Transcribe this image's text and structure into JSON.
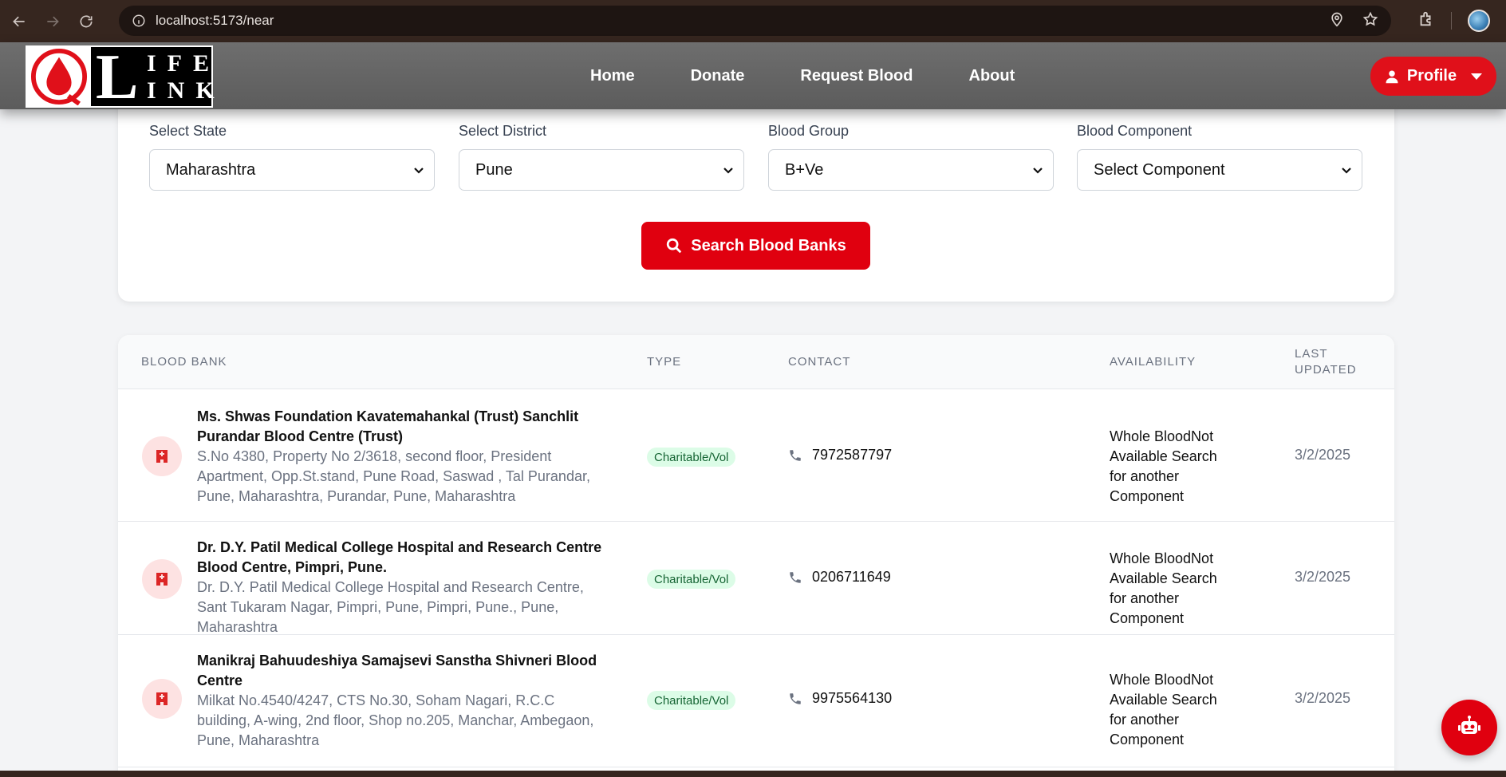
{
  "browser": {
    "url": "localhost:5173/near"
  },
  "header": {
    "logo_letters": {
      "big": "L",
      "top": "IFE",
      "bottom": "INK"
    },
    "nav": [
      "Home",
      "Donate",
      "Request Blood",
      "About"
    ],
    "profile_label": "Profile"
  },
  "search": {
    "fields": [
      {
        "label": "Select State",
        "value": "Maharashtra"
      },
      {
        "label": "Select District",
        "value": "Pune"
      },
      {
        "label": "Blood Group",
        "value": "B+Ve"
      },
      {
        "label": "Blood Component",
        "value": "Select Component"
      }
    ],
    "button_label": "Search Blood Banks"
  },
  "table": {
    "headers": {
      "bank": "BLOOD BANK",
      "type": "TYPE",
      "contact": "CONTACT",
      "availability": "AVAILABILITY",
      "updated_line1": "LAST",
      "updated_line2": "UPDATED"
    },
    "rows": [
      {
        "name": "Ms. Shwas Foundation Kavatemahankal (Trust) Sanchlit Purandar Blood Centre (Trust)",
        "address": "S.No 4380, Property No 2/3618, second floor, President Apartment, Opp.St.stand, Pune Road, Saswad , Tal Purandar, Pune, Maharashtra, Purandar, Pune, Maharashtra",
        "type": "Charitable/Vol",
        "phone": "7972587797",
        "availability": "Whole BloodNot Available Search for another Component",
        "updated": "3/2/2025"
      },
      {
        "name": "Dr. D.Y. Patil Medical College Hospital and Research Centre Blood Centre, Pimpri, Pune.",
        "address": "Dr. D.Y. Patil Medical College Hospital and Research Centre, Sant Tukaram Nagar, Pimpri, Pune, Pimpri, Pune., Pune, Maharashtra",
        "type": "Charitable/Vol",
        "phone": "0206711649",
        "availability": "Whole BloodNot Available Search for another Component",
        "updated": "3/2/2025"
      },
      {
        "name": "Manikraj Bahuudeshiya Samajsevi Sanstha Shivneri Blood Centre",
        "address": "Milkat No.4540/4247, CTS No.30, Soham Nagari, R.C.C building, A-wing, 2nd floor, Shop no.205, Manchar, Ambegaon, Pune, Maharashtra",
        "type": "Charitable/Vol",
        "phone": "9975564130",
        "availability": "Whole BloodNot Available Search for another Component",
        "updated": "3/2/2025"
      }
    ]
  },
  "colors": {
    "brand_red": "#e0000f",
    "badge_bg": "#dcfce7",
    "badge_text": "#166534"
  }
}
